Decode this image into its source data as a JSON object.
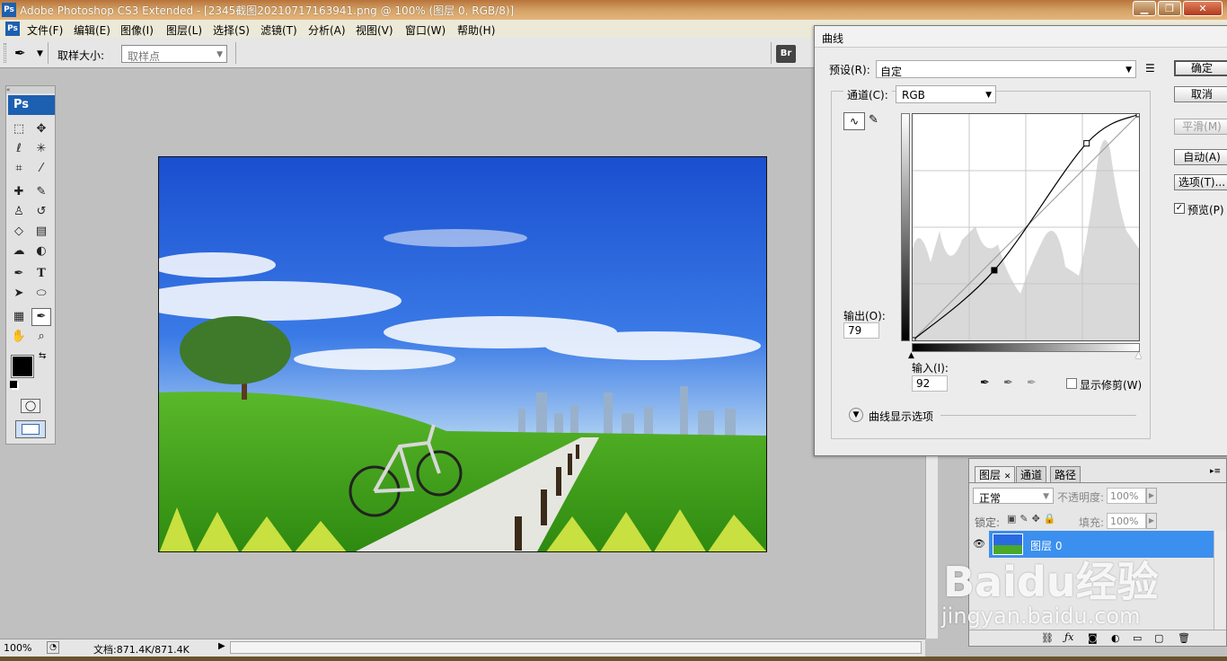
{
  "window": {
    "app_icon": "Ps",
    "title": "Adobe Photoshop CS3 Extended - [2345截图20210717163941.png @ 100% (图层 0, RGB/8)]",
    "controls": [
      "▁",
      "❐",
      "✕"
    ]
  },
  "menu": {
    "items": [
      {
        "id": "file",
        "label": "文件(F)"
      },
      {
        "id": "edit",
        "label": "编辑(E)"
      },
      {
        "id": "image",
        "label": "图像(I)"
      },
      {
        "id": "layer",
        "label": "图层(L)"
      },
      {
        "id": "select",
        "label": "选择(S)"
      },
      {
        "id": "filter",
        "label": "滤镜(T)"
      },
      {
        "id": "analysis",
        "label": "分析(A)"
      },
      {
        "id": "view",
        "label": "视图(V)"
      },
      {
        "id": "window",
        "label": "窗口(W)"
      },
      {
        "id": "help",
        "label": "帮助(H)"
      }
    ]
  },
  "options_bar": {
    "sample_size_label": "取样大小:",
    "sample_size_value": "取样点",
    "bridge_label": "Br"
  },
  "toolbox": {
    "logo": "Ps",
    "type_tool_glyph": "T"
  },
  "status": {
    "zoom": "100%",
    "doc_info": "文档:871.4K/871.4K"
  },
  "curves_dialog": {
    "title": "曲线",
    "preset_label": "预设(R):",
    "preset_value": "自定",
    "channel_label": "通道(C):",
    "channel_value": "RGB",
    "output_label": "输出(O):",
    "output_value": "79",
    "input_label": "输入(I):",
    "input_value": "92",
    "show_clipping": "显示修剪(W)",
    "display_options": "曲线显示选项",
    "buttons": {
      "ok": "确定",
      "cancel": "取消",
      "smooth": "平滑(M)",
      "auto": "自动(A)",
      "options": "选项(T)..."
    },
    "preview_label": "预览(P)",
    "preview_checked": true,
    "curve_points": [
      {
        "input": 0,
        "output": 0
      },
      {
        "input": 92,
        "output": 79
      },
      {
        "input": 196,
        "output": 222
      },
      {
        "input": 255,
        "output": 255
      }
    ]
  },
  "layers_panel": {
    "tabs": [
      "图层",
      "通道",
      "路径"
    ],
    "blend_mode": "正常",
    "opacity_label": "不透明度:",
    "opacity_value": "100%",
    "lock_label": "锁定:",
    "fill_label": "填充:",
    "fill_value": "100%",
    "layer_name": "图层 0"
  },
  "watermark": {
    "brand": "Baidu经验",
    "url": "jingyan.baidu.com"
  }
}
